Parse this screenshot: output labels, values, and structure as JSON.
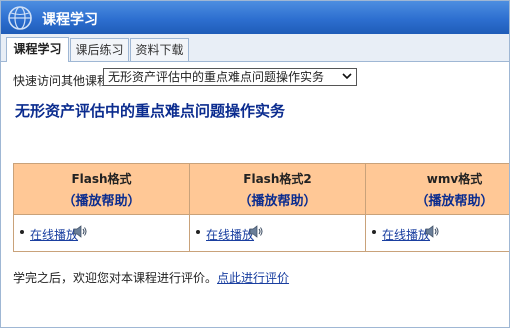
{
  "window": {
    "title": "课程学习"
  },
  "tabs": [
    {
      "label": "课程学习",
      "active": true
    },
    {
      "label": "课后练习",
      "active": false
    },
    {
      "label": "资料下载",
      "active": false
    }
  ],
  "quick_access": {
    "label": "快速访问其他课程：",
    "selected": "无形资产评估中的重点难点问题操作实务"
  },
  "course": {
    "title": "无形资产评估中的重点难点问题操作实务"
  },
  "formats": [
    {
      "name": "Flash格式",
      "help": "（播放帮助）",
      "play_label": "在线播放"
    },
    {
      "name": "Flash格式2",
      "help": "（播放帮助）",
      "play_label": "在线播放"
    },
    {
      "name": "wmv格式",
      "help": "（播放帮助）",
      "play_label": "在线播放"
    }
  ],
  "footer": {
    "text": "学完之后，欢迎您对本课程进行评价。",
    "link": "点此进行评价"
  },
  "colors": {
    "titlebar": "#2d6fd0",
    "format_header_bg": "#ffc896",
    "link": "#1a3fa0",
    "course_title": "#0b2c8f"
  }
}
